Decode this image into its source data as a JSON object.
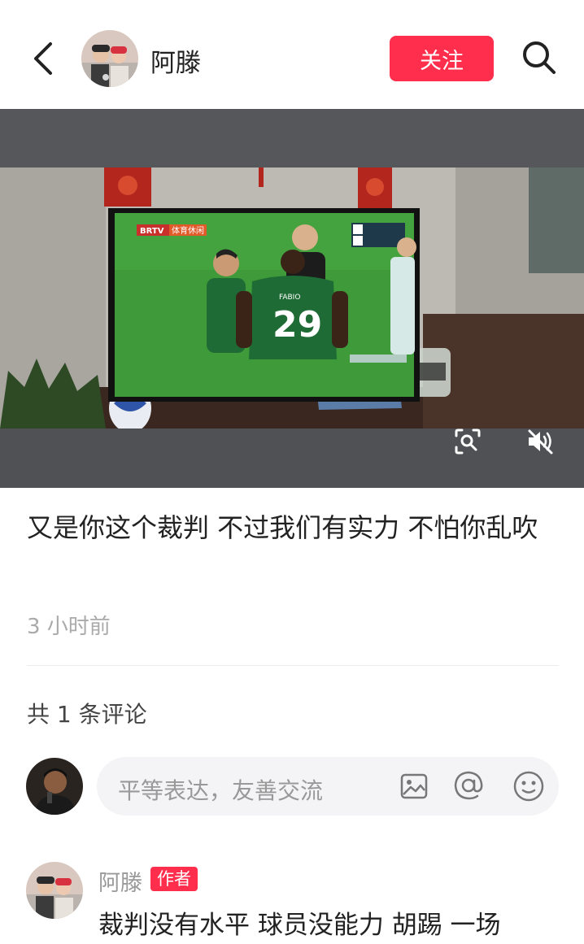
{
  "header": {
    "author_name": "阿滕",
    "follow_label": "关注"
  },
  "video": {
    "tv_channel_logo": "BRTV",
    "tv_channel_name": "体育休闲",
    "jersey_number": "29",
    "jersey_name": "FABIO"
  },
  "post": {
    "caption": "又是你这个裁判  不过我们有实力 不怕你乱吹",
    "time": "3 小时前"
  },
  "comments": {
    "count_text": "共 1 条评论",
    "input_placeholder": "平等表达，友善交流",
    "items": [
      {
        "name": "阿滕",
        "badge": "作者",
        "text": "裁判没有水平  球员没能力  胡踢 一场"
      }
    ]
  },
  "colors": {
    "accent": "#ff2e4d",
    "pitch": "#3f9a3a",
    "jersey": "#1f6b35"
  }
}
